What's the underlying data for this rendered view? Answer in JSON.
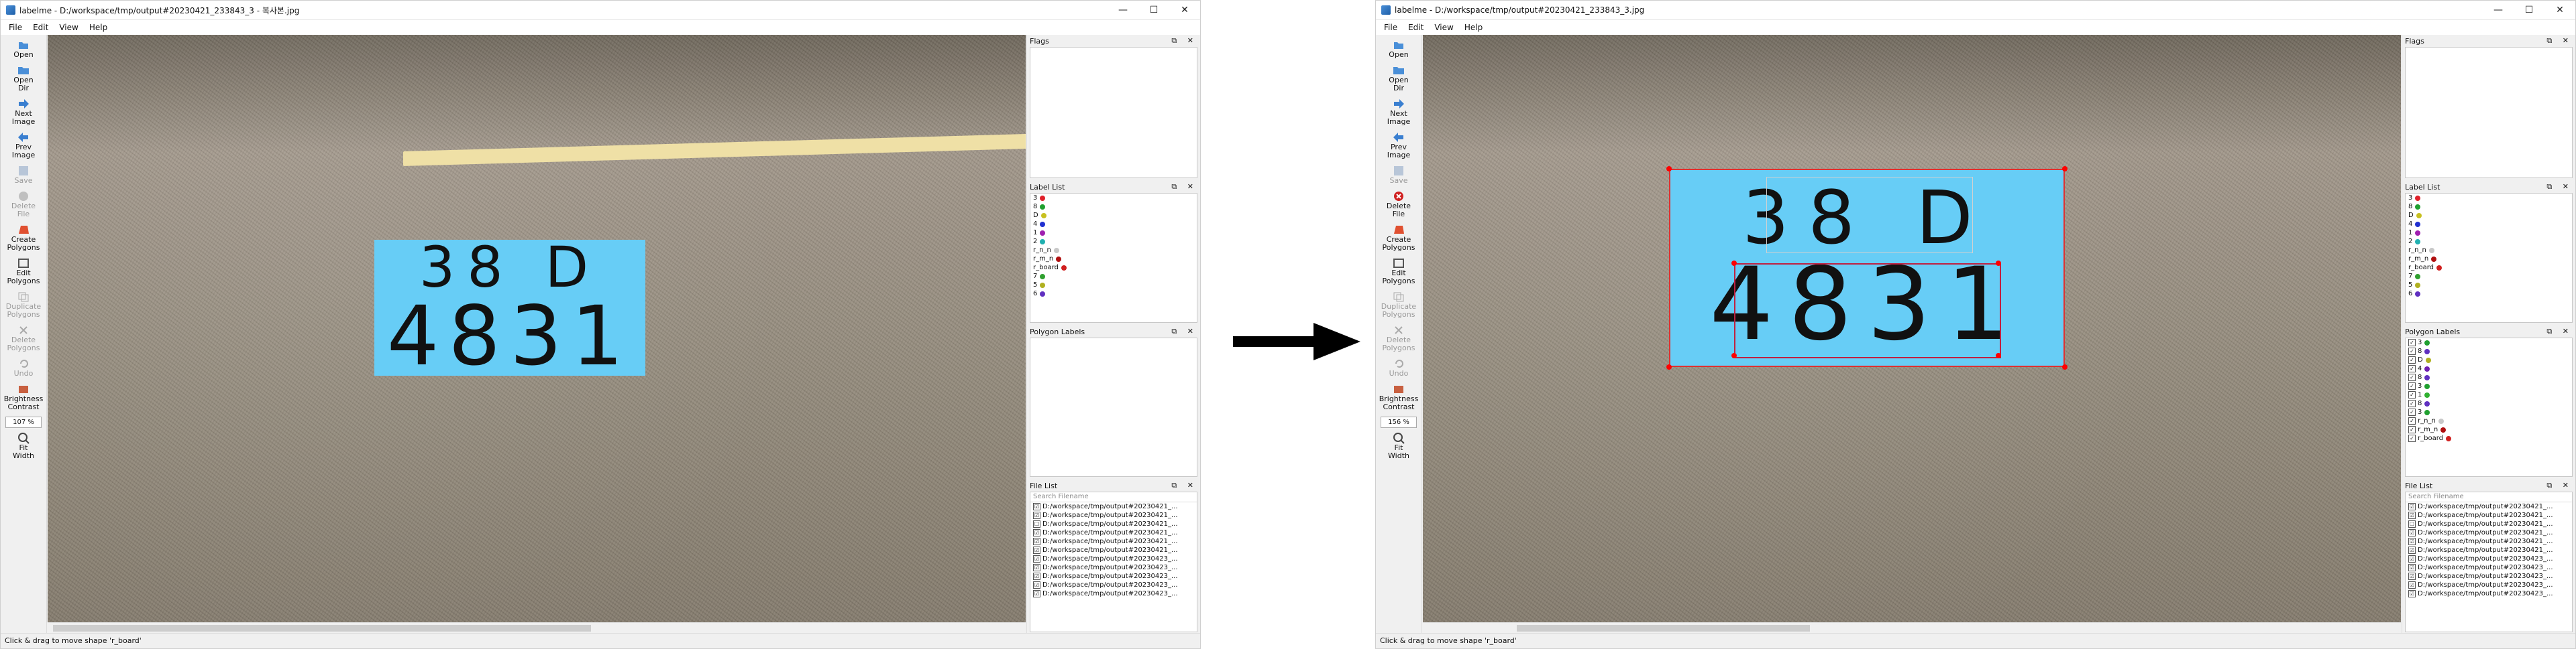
{
  "left": {
    "title": "labelme - D:/workspace/tmp/output#20230421_233843_3 - 복사본.jpg",
    "zoom": "107 %",
    "status": "Click & drag to move shape 'r_board'"
  },
  "right": {
    "title": "labelme - D:/workspace/tmp/output#20230421_233843_3.jpg",
    "zoom": "156 %",
    "status": "Click & drag to move shape 'r_board'"
  },
  "menu": {
    "file": "File",
    "edit": "Edit",
    "view": "View",
    "help": "Help"
  },
  "window_buttons": {
    "min": "—",
    "max": "☐",
    "close": "✕"
  },
  "tools": {
    "open": "Open",
    "open_dir": "Open\nDir",
    "next_image": "Next\nImage",
    "prev_image": "Prev\nImage",
    "save": "Save",
    "delete_file": "Delete\nFile",
    "create_polygons": "Create\nPolygons",
    "edit_polygons": "Edit\nPolygons",
    "duplicate_polygons": "Duplicate\nPolygons",
    "delete_polygons": "Delete\nPolygons",
    "undo": "Undo",
    "brightness_contrast": "Brightness\nContrast",
    "fit_width": "Fit\nWidth"
  },
  "board": {
    "line1": "38 D",
    "line2": "4831",
    "color": "#67cdf6"
  },
  "panels": {
    "flags": "Flags",
    "label_list": "Label List",
    "polygon_labels": "Polygon Labels",
    "file_list": "File List",
    "search_placeholder": "Search Filename",
    "dock_buttons": "⧉ ✕"
  },
  "label_list": [
    {
      "name": "3",
      "color": "#e0202a"
    },
    {
      "name": "8",
      "color": "#20a030"
    },
    {
      "name": "D",
      "color": "#c8c020"
    },
    {
      "name": "4",
      "color": "#2030d0"
    },
    {
      "name": "1",
      "color": "#a020b0"
    },
    {
      "name": "2",
      "color": "#20b0b0"
    },
    {
      "name": "r_n_n",
      "color": "#c8c8c8"
    },
    {
      "name": "r_m_n",
      "color": "#b01010"
    },
    {
      "name": "r_board",
      "color": "#d02020"
    },
    {
      "name": "7",
      "color": "#30a030"
    },
    {
      "name": "5",
      "color": "#b0b020"
    },
    {
      "name": "6",
      "color": "#6030c0"
    }
  ],
  "polygon_labels": [
    {
      "name": "3",
      "color": "#20a030"
    },
    {
      "name": "8",
      "color": "#6030c0"
    },
    {
      "name": "D",
      "color": "#b0b020"
    },
    {
      "name": "4",
      "color": "#7020b0"
    },
    {
      "name": "8",
      "color": "#6030c0"
    },
    {
      "name": "3",
      "color": "#20a030"
    },
    {
      "name": "1",
      "color": "#30b030"
    },
    {
      "name": "8",
      "color": "#6030c0"
    },
    {
      "name": "3",
      "color": "#20a030"
    },
    {
      "name": "r_n_n",
      "color": "#c8c8c8"
    },
    {
      "name": "r_m_n",
      "color": "#b01010"
    },
    {
      "name": "r_board",
      "color": "#d02020"
    }
  ],
  "file_list": [
    {
      "path": "D:/workspace/tmp/output#20230421_...",
      "checked": "☑"
    },
    {
      "path": "D:/workspace/tmp/output#20230421_...",
      "checked": "☑"
    },
    {
      "path": "D:/workspace/tmp/output#20230421_...",
      "checked": "☐"
    },
    {
      "path": "D:/workspace/tmp/output#20230421_...",
      "checked": "☑"
    },
    {
      "path": "D:/workspace/tmp/output#20230421_...",
      "checked": "☑"
    },
    {
      "path": "D:/workspace/tmp/output#20230421_...",
      "checked": "☑"
    },
    {
      "path": "D:/workspace/tmp/output#20230423_...",
      "checked": "☑"
    },
    {
      "path": "D:/workspace/tmp/output#20230423_...",
      "checked": "☑"
    },
    {
      "path": "D:/workspace/tmp/output#20230423_...",
      "checked": "☑"
    },
    {
      "path": "D:/workspace/tmp/output#20230423_...",
      "checked": "☑"
    },
    {
      "path": "D:/workspace/tmp/output#20230423_...",
      "checked": "☑"
    },
    {
      "path": "D:/workspace/tmp/output#20230423_...",
      "checked": "☑"
    }
  ]
}
